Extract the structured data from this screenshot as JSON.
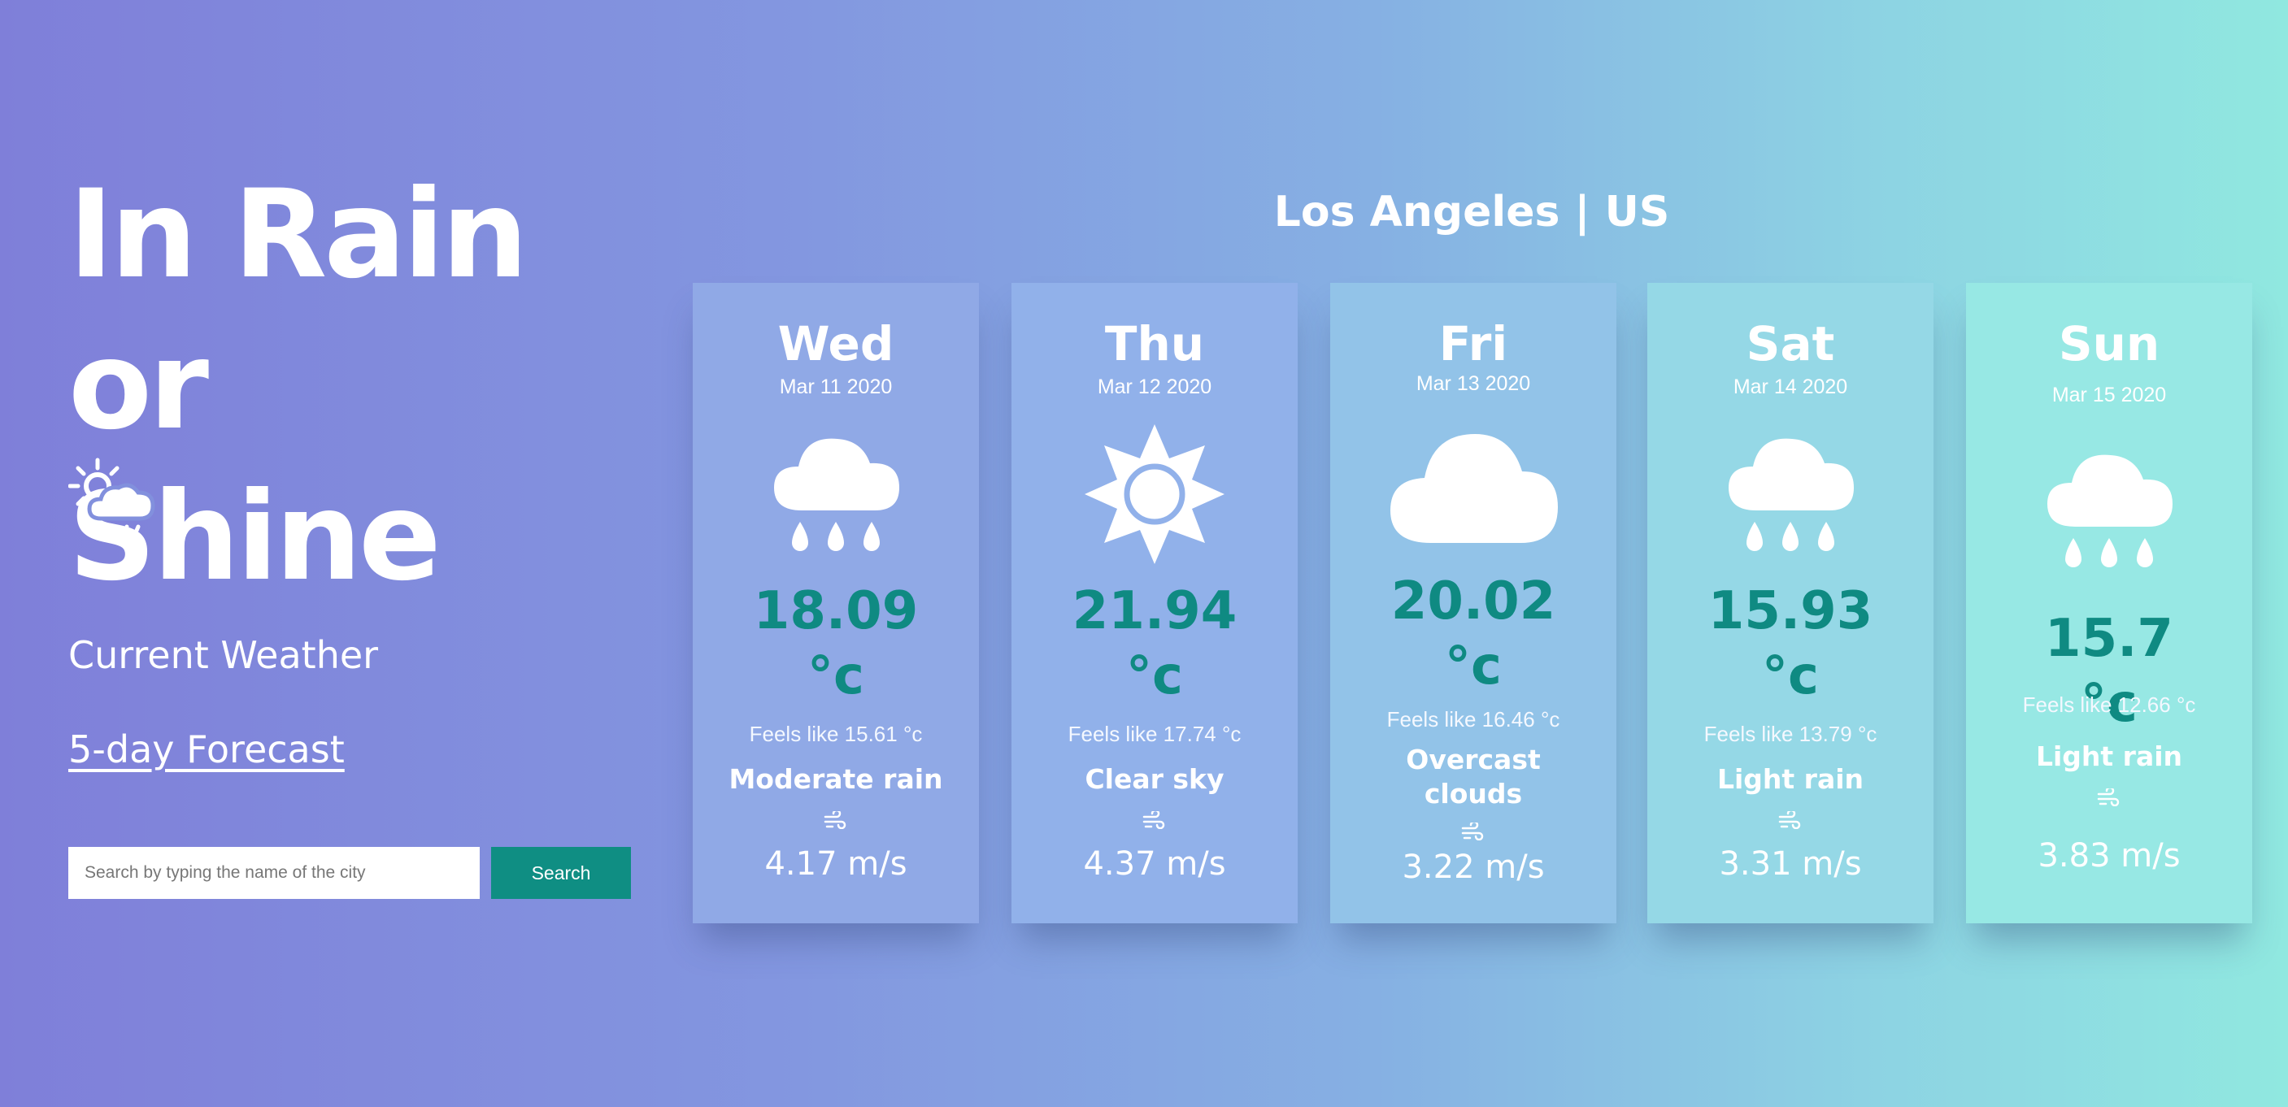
{
  "hero": {
    "title_line1": "In Rain or",
    "title_line2": "Shine",
    "icon": "sun-cloud-rain-icon"
  },
  "nav": {
    "current_weather": "Current Weather",
    "forecast": "5-day Forecast"
  },
  "search": {
    "placeholder": "Search by typing the name of the city",
    "value": "",
    "button_label": "Search"
  },
  "location": "Los Angeles | US",
  "colors": {
    "gradient_start": "#7f7fd9",
    "gradient_end": "#90e8e0",
    "accent": "#0f8e83",
    "temperature": "#0f8a82"
  },
  "forecast": [
    {
      "day": "Wed",
      "date": "Mar 11 2020",
      "icon": "cloud-rain-icon",
      "temperature": "18.09 °c",
      "feels_like": "Feels like 15.61 °c",
      "description": "Moderate rain",
      "wind_icon": "wind-icon",
      "wind_speed": "4.17 m/s",
      "card_color": "#90a9e6"
    },
    {
      "day": "Thu",
      "date": "Mar 12 2020",
      "icon": "sun-icon",
      "temperature": "21.94 °c",
      "feels_like": "Feels like 17.74 °c",
      "description": "Clear sky",
      "wind_icon": "wind-icon",
      "wind_speed": "4.37 m/s",
      "card_color": "#91b1ea"
    },
    {
      "day": "Fri",
      "date": "Mar 13 2020",
      "icon": "cloud-icon",
      "temperature": "20.02 °c",
      "feels_like": "Feels like 16.46 °c",
      "description": "Overcast clouds",
      "wind_icon": "wind-icon",
      "wind_speed": "3.22 m/s",
      "card_color": "#92c3e8"
    },
    {
      "day": "Sat",
      "date": "Mar 14 2020",
      "icon": "cloud-rain-icon",
      "temperature": "15.93 °c",
      "feels_like": "Feels like 13.79 °c",
      "description": "Light rain",
      "wind_icon": "wind-icon",
      "wind_speed": "3.31 m/s",
      "card_color": "#95d8e6"
    },
    {
      "day": "Sun",
      "date": "Mar 15 2020",
      "icon": "cloud-rain-icon",
      "temperature": "15.7 °c",
      "feels_like": "Feels like 12.66 °c",
      "description": "Light rain",
      "wind_icon": "wind-icon",
      "wind_speed": "3.83 m/s",
      "card_color": "#97e8e4"
    }
  ]
}
